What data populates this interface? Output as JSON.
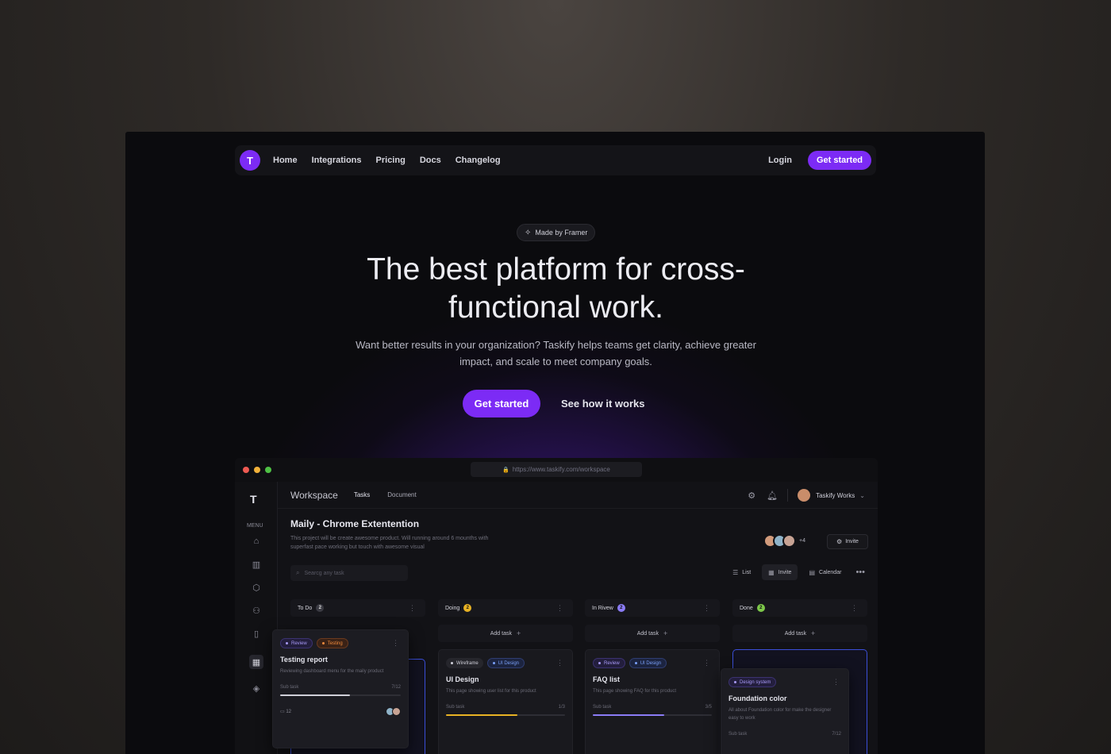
{
  "nav": {
    "logo_letter": "T",
    "links": [
      "Home",
      "Integrations",
      "Pricing",
      "Docs",
      "Changelog"
    ],
    "login": "Login",
    "cta": "Get started"
  },
  "hero": {
    "badge": "Made by Framer",
    "title": "The best platform for cross-functional work.",
    "subtitle": "Want better results in your organization? Taskify helps teams get clarity, achieve greater impact, and scale to meet company goals.",
    "cta_primary": "Get started",
    "cta_secondary": "See how it works"
  },
  "app": {
    "url": "https://www.taskify.com/workspace",
    "sidebar": {
      "logo_letter": "T",
      "menu_label": "MENU"
    },
    "topbar": {
      "title": "Workspace",
      "tabs": [
        "Tasks",
        "Document"
      ],
      "user": "Taskify Works"
    },
    "project": {
      "title": "Maily - Chrome Extentention",
      "description": "This project will be create awesome product. Will running around 6 mounths with superfast pace working but touch with awesome visual",
      "more_members": "+4",
      "invite": "Invite"
    },
    "search_placeholder": "Searcg any task",
    "views": [
      "List",
      "Invite",
      "Calendar"
    ],
    "columns": [
      {
        "name": "To Do",
        "count": "2",
        "color": "#3a3a42"
      },
      {
        "name": "Doing",
        "count": "2",
        "color": "#e8b224"
      },
      {
        "name": "In Rivew",
        "count": "2",
        "color": "#8b7cf6"
      },
      {
        "name": "Done",
        "count": "2",
        "color": "#7ec94a"
      }
    ],
    "add_task": "Add task",
    "cards": {
      "testing": {
        "tags": [
          "Review",
          "Testing"
        ],
        "title": "Testing report",
        "desc": "Reviewing dashboard menu for the maily product",
        "subtask": "Sub task",
        "progress_text": "7/12",
        "progress": 0.58,
        "comments": "12"
      },
      "ui": {
        "tags": [
          "Wireframe",
          "UI Design"
        ],
        "title": "UI Design",
        "desc": "This page showing user list for this product",
        "subtask": "Sub task",
        "progress_text": "1/3",
        "progress": 0.6
      },
      "faq": {
        "tags": [
          "Review",
          "UI Design"
        ],
        "title": "FAQ list",
        "desc": "This page showing FAQ for this product",
        "subtask": "Sub task",
        "progress_text": "3/5",
        "progress": 0.6
      },
      "foundation": {
        "tags": [
          "Design system"
        ],
        "title": "Foundation color",
        "desc": "All about Foundation color for make the designer easy to work",
        "subtask": "Sub task",
        "progress_text": "7/12"
      }
    },
    "colors": {
      "accent": "#7c2bf5",
      "tag_review": "#8b7cf6",
      "tag_testing": "#f08a3c",
      "tag_ui": "#5b8cf7",
      "progress_yellow": "#e8b224",
      "progress_purple": "#8b7cf6"
    }
  }
}
